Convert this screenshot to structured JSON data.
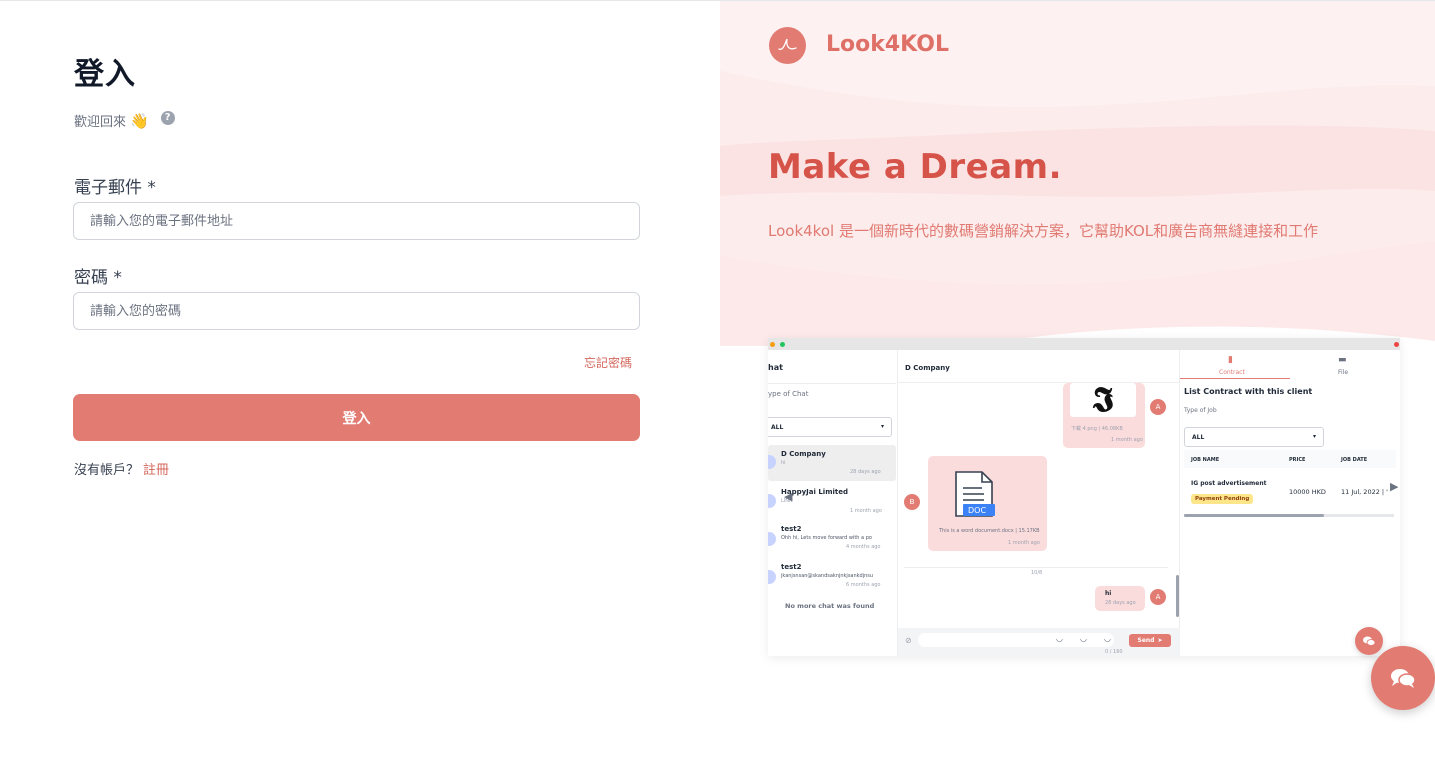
{
  "login": {
    "title": "登入",
    "subtitle": "歡迎回來",
    "wave_emoji": "👋",
    "help_icon": "?",
    "email_label": "電子郵件 *",
    "email_placeholder": "請輸入您的電子郵件地址",
    "email_value": "",
    "password_label": "密碼 *",
    "password_placeholder": "請輸入您的密碼",
    "password_value": "",
    "forgot_link": "忘記密碼",
    "submit_label": "登入",
    "no_account_text": "沒有帳戶？",
    "signup_link": "註冊"
  },
  "brand": {
    "name": "Look4KOL",
    "headline": "Make a Dream.",
    "description": "Look4kol 是一個新時代的數碼營銷解決方案，它幫助KOL和廣告商無縫連接和工作",
    "accent_color": "#e27b72",
    "headline_color": "#d6534a"
  },
  "mockup": {
    "chat_header": "hat",
    "type_of_chat_label": "ype of Chat",
    "filter_value": "ALL",
    "conversations": [
      {
        "name": "D Company",
        "preview": "hi",
        "time": "28 days ago"
      },
      {
        "name": "HappyJai Limited",
        "preview": "LINK",
        "time": "1 month ago"
      },
      {
        "name": "test2",
        "preview": "Ohh hi, Lets move forward with a po",
        "time": "4 months ago"
      },
      {
        "name": "test2",
        "preview": "jkanjsnsan@skandsaknjnkjsankdjnsu",
        "time": "6 months ago"
      }
    ],
    "no_more_chat": "No more chat was found",
    "active_chat_title": "D Company",
    "image_caption": "下載 4.png | 46.08KB",
    "image_time": "1 month ago",
    "doc_label": "DOC",
    "doc_caption": "This is a word document.docx | 15.17KB",
    "doc_time": "1 month ago",
    "date_divider": "10/8",
    "last_message": "hi",
    "last_message_time": "28 days ago",
    "sender_initial_me": "A",
    "sender_initial_other": "B",
    "send_label": "Send",
    "char_count": "0 / 160",
    "tab_contract": "Contract",
    "tab_file": "File",
    "contract_title": "List Contract with this client",
    "type_of_job_label": "Type of Job",
    "job_filter_value": "ALL",
    "table_headers": [
      "JOB NAME",
      "PRICE",
      "JOB DATE"
    ],
    "table_rows": [
      {
        "job_name": "IG post advertisement",
        "status": "Payment Pending",
        "price": "10000 HKD",
        "job_date": "11 Jul, 2022 | '"
      }
    ]
  }
}
